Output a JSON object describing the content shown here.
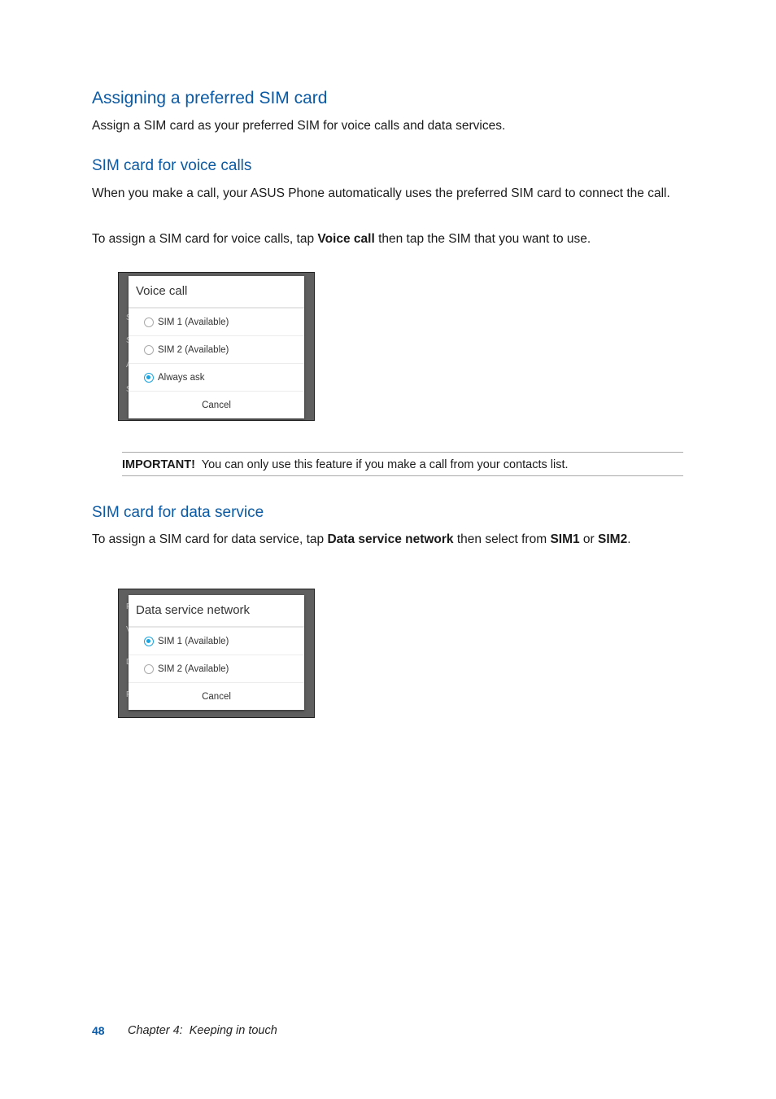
{
  "section": {
    "title": "Assigning a preferred SIM card",
    "intro": "Assign a SIM card as your preferred SIM for voice calls and data services."
  },
  "voice": {
    "heading": "SIM card for voice calls",
    "para1": "When you make a call, your ASUS Phone automatically uses the preferred SIM card to connect the call.",
    "para2_pre": "To assign a SIM card for voice calls, tap ",
    "para2_bold": "Voice call",
    "para2_post": " then tap the SIM that you want to use.",
    "dialog": {
      "title": "Voice call",
      "options": [
        {
          "label": "SIM 1 (Available)",
          "selected": false
        },
        {
          "label": "SIM 2 (Available)",
          "selected": false
        },
        {
          "label": "Always ask",
          "selected": true
        }
      ],
      "cancel": "Cancel"
    }
  },
  "note": {
    "label": "IMPORTANT!",
    "text": "You can only use this feature if you make a call from your contacts list."
  },
  "data": {
    "heading": "SIM card for data service",
    "para_pre": "To assign a SIM card for data service, tap ",
    "para_bold1": "Data service network",
    "para_mid": " then select from ",
    "para_bold2": "SIM1",
    "para_or": " or ",
    "para_bold3": "SIM2",
    "para_end": ".",
    "dialog": {
      "title": "Data service network",
      "options": [
        {
          "label": "SIM 1 (Available)",
          "selected": true
        },
        {
          "label": "SIM 2 (Available)",
          "selected": false
        }
      ],
      "cancel": "Cancel"
    }
  },
  "footer": {
    "page": "48",
    "chapter": "Chapter 4:  Keeping in touch"
  }
}
